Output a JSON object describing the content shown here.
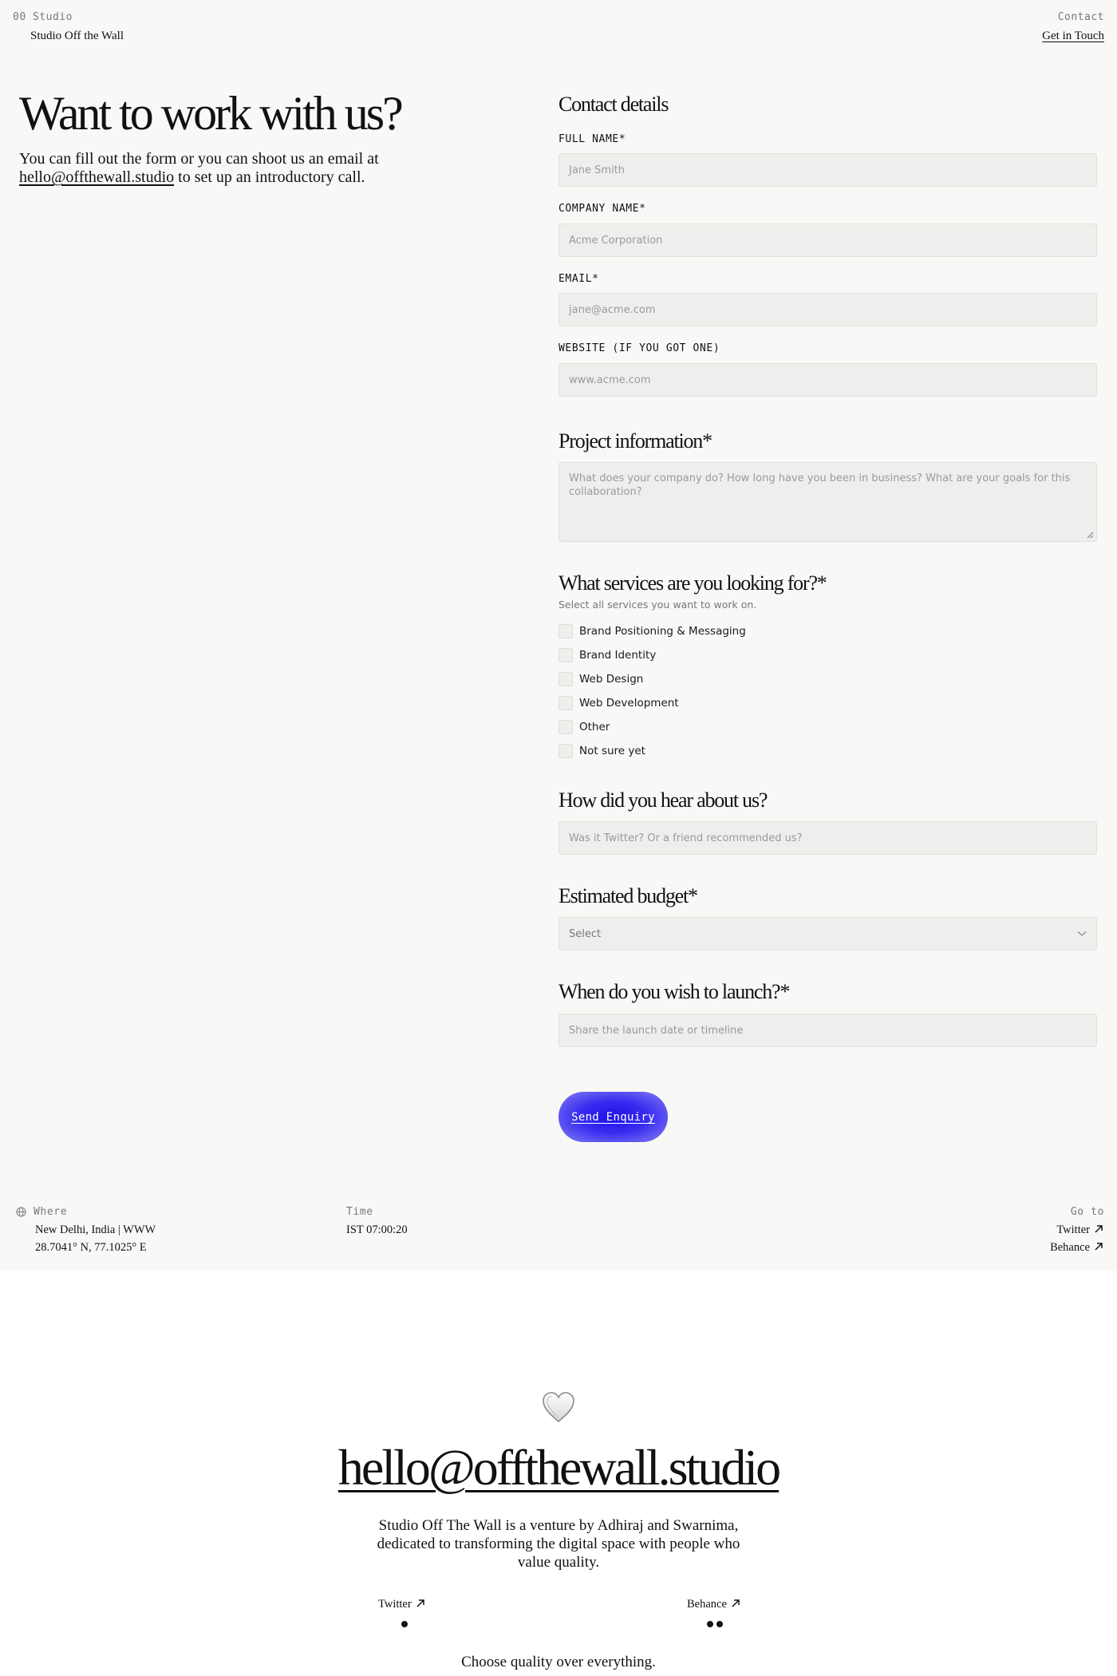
{
  "header": {
    "index": "00",
    "section": "Studio",
    "brand": "Studio Off the Wall",
    "contact_label": "Contact",
    "contact_link": "Get in Touch"
  },
  "hero": {
    "title": "Want to work with us?",
    "text_before": "You can fill out the form or you can shoot us an email at",
    "email": "hello@offthewall.studio",
    "text_after": "to set up an introductory call."
  },
  "form": {
    "contact_heading": "Contact details",
    "fields": [
      {
        "label": "FULL NAME*",
        "placeholder": "Jane Smith"
      },
      {
        "label": "COMPANY NAME*",
        "placeholder": "Acme Corporation"
      },
      {
        "label": "EMAIL*",
        "placeholder": "jane@acme.com"
      },
      {
        "label": "WEBSITE (IF YOU GOT ONE)",
        "placeholder": "www.acme.com"
      }
    ],
    "project_heading": "Project information*",
    "project_placeholder": "What does your company do? How long have you been in business? What are your goals for this collaboration?",
    "services_heading": "What services are you looking for?*",
    "services_hint": "Select all services you want to work on.",
    "services": [
      "Brand Positioning & Messaging",
      "Brand Identity",
      "Web Design",
      "Web Development",
      "Other",
      "Not sure yet"
    ],
    "hear_heading": "How did you hear about us?",
    "hear_placeholder": "Was it Twitter? Or a friend recommended us?",
    "budget_heading": "Estimated budget*",
    "budget_value": "Select",
    "launch_heading": "When do you wish to launch?*",
    "launch_placeholder": "Share the launch date or timeline",
    "submit_label": "Send Enquiry",
    "submit_color": "#2a1ff0"
  },
  "info_bar": {
    "where_label": "Where",
    "where_line1": "New Delhi, India | WWW",
    "where_line2": "28.7041° N, 77.1025° E",
    "time_label": "Time",
    "time_value": "IST 07:00:20",
    "goto_label": "Go to",
    "links": [
      "Twitter",
      "Behance"
    ]
  },
  "footer": {
    "icon": "heart-icon",
    "email": "hello@offthewall.studio",
    "tagline": "Studio Off The Wall is a venture by Adhiraj and Swarnima, dedicated to transforming the digital space with people who value quality.",
    "links": [
      "Twitter",
      "Behance"
    ],
    "motto": "Choose quality over everything."
  }
}
